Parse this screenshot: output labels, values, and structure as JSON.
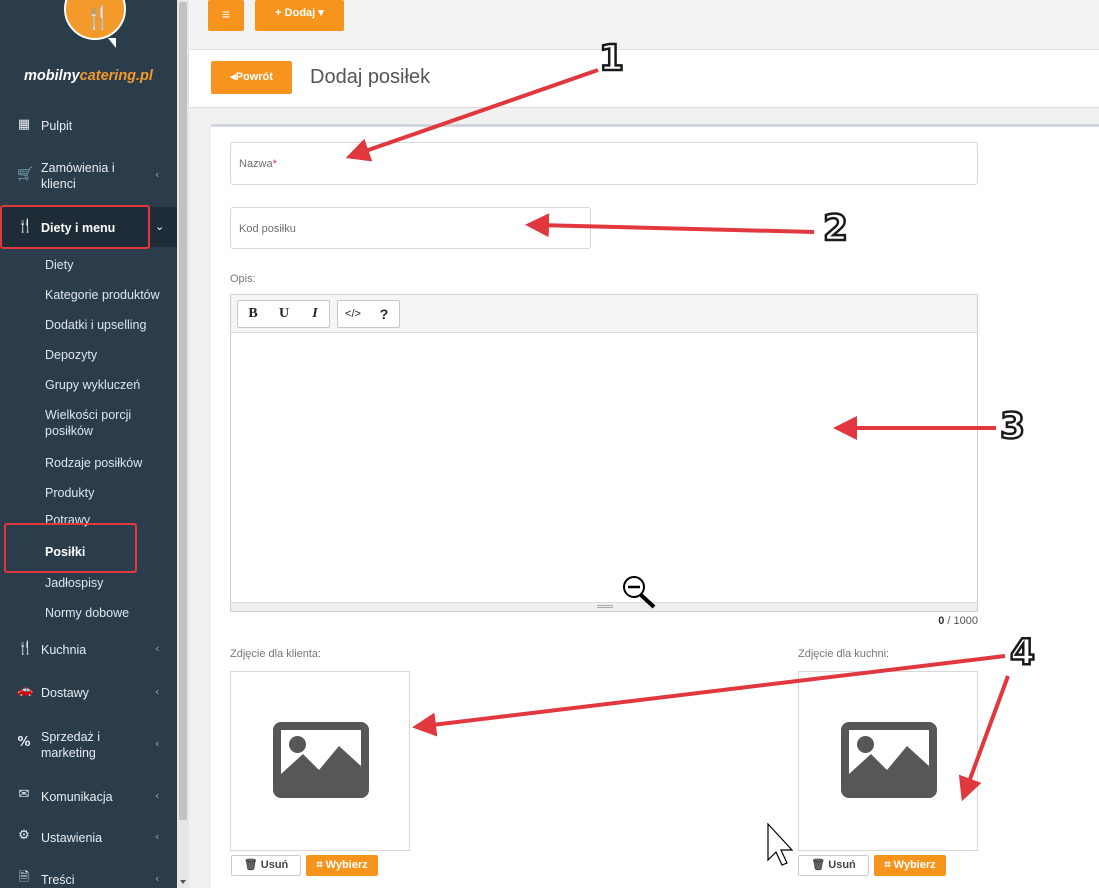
{
  "brand": {
    "name_white": "mobilny",
    "name_accent": "catering.pl",
    "accent_color": "#f7941d"
  },
  "topbar": {
    "menu_icon": "hamburger-icon",
    "add_label": "+ Dodaj",
    "add_caret": "▾"
  },
  "header": {
    "back_label": "Powrót",
    "title": "Dodaj posiłek"
  },
  "sidebar": {
    "items": [
      {
        "icon": "dashboard-icon",
        "label": "Pulpit"
      },
      {
        "icon": "cart-icon",
        "label": "Zamówienia i klienci"
      },
      {
        "icon": "cutlery-icon",
        "label": "Diety i menu"
      },
      {
        "icon": "fork-icon",
        "label": "Kuchnia"
      },
      {
        "icon": "car-icon",
        "label": "Dostawy"
      },
      {
        "icon": "percent-icon",
        "label": "Sprzedaż i marketing"
      },
      {
        "icon": "envelope-icon",
        "label": "Komunikacja"
      },
      {
        "icon": "gear-icon",
        "label": "Ustawienia"
      },
      {
        "icon": "document-icon",
        "label": "Treści"
      }
    ],
    "subitems": [
      "Diety",
      "Kategorie produktów",
      "Dodatki i upselling",
      "Depozyty",
      "Grupy wykluczeń",
      "Wielkości porcji posiłków",
      "Rodzaje posiłków",
      "Produkty",
      "Potrawy",
      "Posiłki",
      "Jadłospisy",
      "Normy dobowe"
    ]
  },
  "form": {
    "name_placeholder": "Nazwa",
    "required_mark": "*",
    "code_placeholder": "Kod posiłku",
    "desc_label": "Opis:",
    "editor_buttons": [
      "B",
      "U",
      "I",
      "</>",
      "?"
    ],
    "char_count": "0",
    "char_max": "/ 1000",
    "client_photo_label": "Zdjęcie dla klienta:",
    "kitchen_photo_label": "Zdjęcie dla kuchni:",
    "remove_label": "Usuń",
    "choose_label": "Wybierz"
  },
  "annotations": {
    "numbers": [
      "1",
      "2",
      "3",
      "4"
    ],
    "arrow_color": "#e0383e"
  }
}
